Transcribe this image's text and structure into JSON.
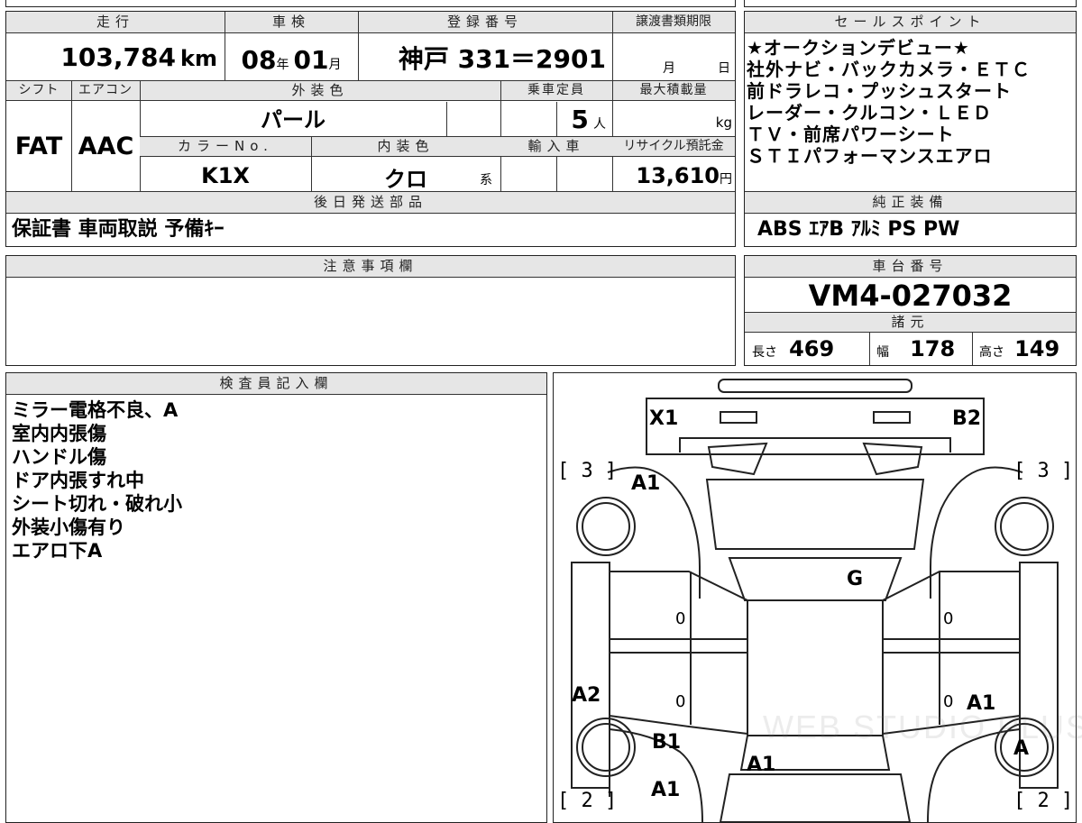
{
  "vehicle": {
    "mileage_label": "走行",
    "mileage_value": "103,784",
    "mileage_unit": "km",
    "inspection_label": "車検",
    "inspection_year": "08",
    "inspection_year_unit": "年",
    "inspection_month": "01",
    "inspection_month_unit": "月",
    "registration_label": "登録番号",
    "registration_value": "神戸 331＝2901",
    "transfer_doc_label": "譲渡書類期限",
    "transfer_month_unit": "月",
    "transfer_day_unit": "日",
    "shift_label": "シフト",
    "shift_value": "FAT",
    "ac_label": "エアコン",
    "ac_value": "AAC",
    "exterior_color_label": "外装色",
    "exterior_color_value": "パール",
    "capacity_label": "乗車定員",
    "capacity_value": "5",
    "capacity_unit": "人",
    "max_load_label": "最大積載量",
    "max_load_unit": "kg",
    "color_no_label": "カラーNo.",
    "color_no_value": "K1X",
    "interior_color_label": "内装色",
    "interior_color_value": "クロ",
    "interior_color_suffix": "系",
    "import_label": "輸入車",
    "recycle_label": "リサイクル預託金",
    "recycle_value": "13,610",
    "recycle_unit": "円"
  },
  "later_parts": {
    "label": "後日発送部品",
    "value": "保証書 車両取説 予備ｷｰ"
  },
  "sales_points": {
    "label": "セールスポイント",
    "lines": [
      "★オークションデビュー★",
      "社外ナビ・バックカメラ・ＥＴＣ",
      "前ドラレコ・プッシュスタート",
      "レーダー・クルコン・ＬＥＤ",
      "ＴＶ・前席パワーシート",
      "ＳＴＩパフォーマンスエアロ"
    ]
  },
  "genuine_equipment": {
    "label": "純正装備",
    "value": "ABS ｴｱB ｱﾙﾐ PS PW"
  },
  "caution": {
    "label": "注意事項欄"
  },
  "chassis": {
    "label": "車台番号",
    "value": "VM4-027032"
  },
  "specs": {
    "label": "諸元",
    "length_label": "長さ",
    "length_value": "469",
    "width_label": "幅",
    "width_value": "178",
    "height_label": "高さ",
    "height_value": "149"
  },
  "inspector": {
    "label": "検査員記入欄",
    "notes": [
      "ミラー電格不良、A",
      "室内内張傷",
      "ハンドル傷",
      "ドア内張すれ中",
      "シート切れ・破れ小",
      "外装小傷有り",
      "エアロ下A"
    ]
  },
  "diagram": {
    "marks": {
      "x1": "X1",
      "b2": "B2",
      "a1_front_left": "A1",
      "g": "G",
      "zero_1": "0",
      "zero_2": "0",
      "zero_3": "0",
      "zero_4": "0",
      "a2": "A2",
      "a1_right": "A1",
      "b1": "B1",
      "a_wheel": "A",
      "a1_rear_center": "A1",
      "a1_rear_left": "A1"
    },
    "brackets": {
      "front_left": "[ 3 ]",
      "front_right": "[ 3 ]",
      "rear_left": "[ 2 ]",
      "rear_right": "[ 2 ]"
    },
    "watermark": "WEB STUDIO PLUS"
  }
}
